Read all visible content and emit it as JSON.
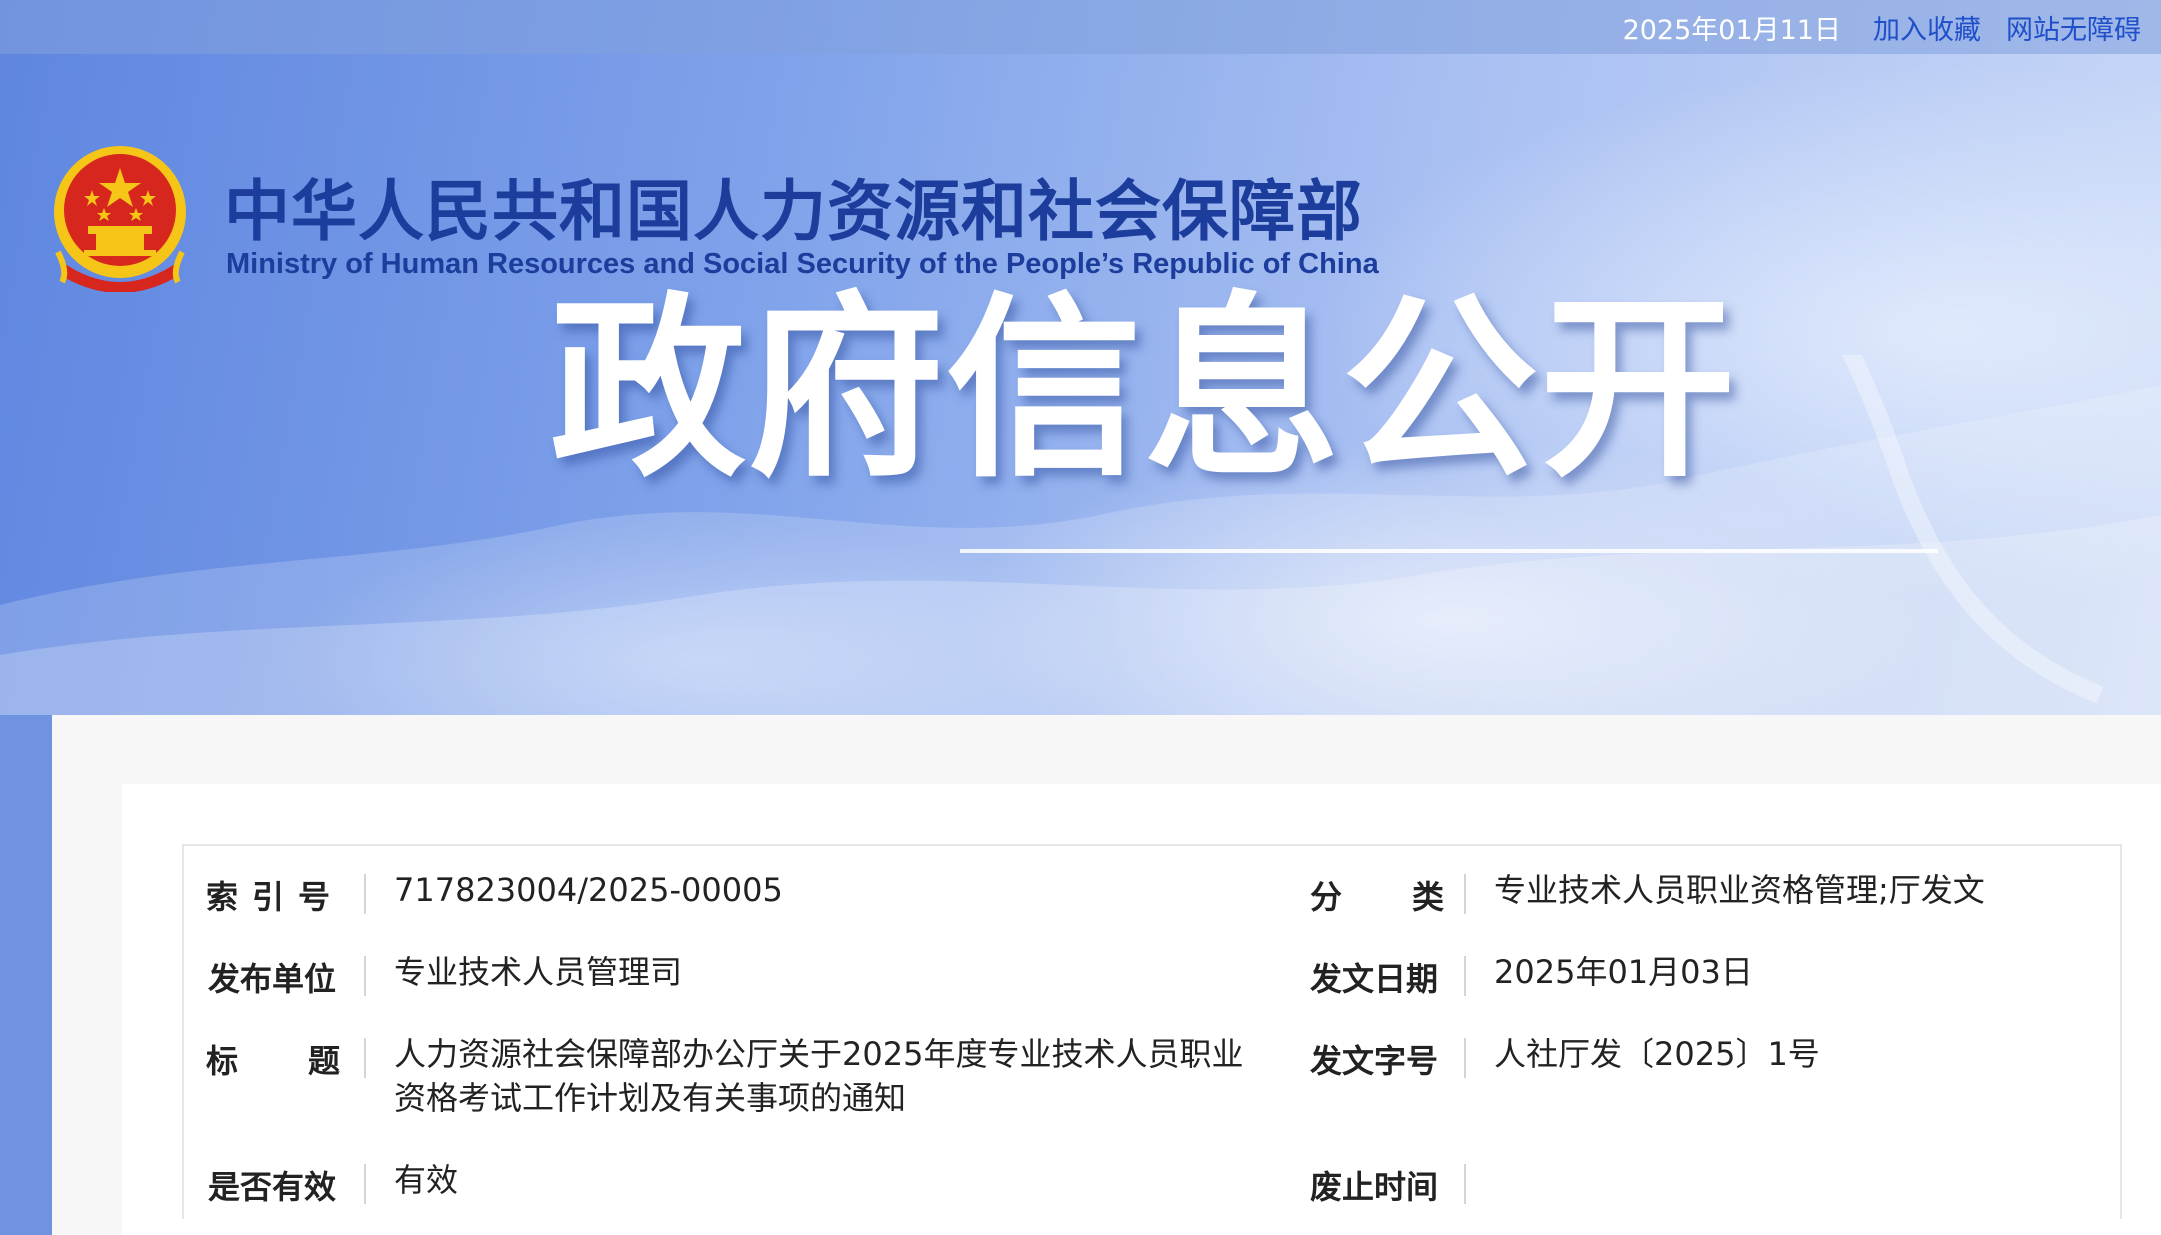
{
  "topbar": {
    "date": "2025年01月11日",
    "favorite_link": "加入收藏",
    "accessibility_link": "网站无障碍"
  },
  "header": {
    "org_name_cn": "中华人民共和国人力资源和社会保障部",
    "org_name_en": "Ministry of Human Resources and Social Security of the People’s Republic of China",
    "banner_title": "政府信息公开"
  },
  "meta": {
    "index_no": {
      "label": "索引号",
      "value": "717823004/2025-00005"
    },
    "category": {
      "label": "分类",
      "value": "专业技术人员职业资格管理;厅发文"
    },
    "publisher": {
      "label": "发布单位",
      "value": "专业技术人员管理司"
    },
    "issue_date": {
      "label": "发文日期",
      "value": "2025年01月03日"
    },
    "title": {
      "label": "标题",
      "value": "人力资源社会保障部办公厅关于2025年度专业技术人员职业资格考试工作计划及有关事项的通知"
    },
    "doc_no": {
      "label": "发文字号",
      "value": "人社厅发〔2025〕1号"
    },
    "validity": {
      "label": "是否有效",
      "value": "有效"
    },
    "repeal_time": {
      "label": "废止时间",
      "value": ""
    }
  },
  "colors": {
    "brand_blue": "#1c3d9c",
    "link_blue": "#1f4fc9",
    "emblem_red": "#d7261e",
    "emblem_gold": "#f5c518"
  },
  "icons": {
    "emblem": "national-emblem-icon"
  }
}
